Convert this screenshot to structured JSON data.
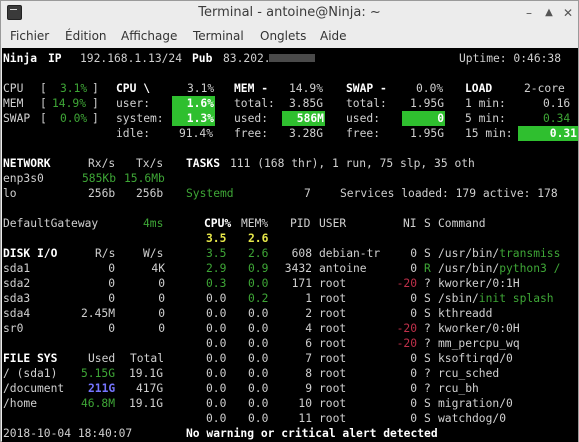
{
  "window": {
    "title": "Terminal - antoine@Ninja: ~"
  },
  "menu": [
    "Fichier",
    "Édition",
    "Affichage",
    "Terminal",
    "Onglets",
    "Aide"
  ],
  "header": {
    "host": "Ninja",
    "ip_label": "IP",
    "ip": "192.168.1.13/24",
    "pub_label": "Pub",
    "pub": "83.202.",
    "uptime": "Uptime: 0:46:38"
  },
  "quicklook": {
    "labels": [
      "CPU",
      "MEM",
      "SWAP"
    ],
    "values": [
      "3.1%",
      "14.9%",
      "0.0%"
    ],
    "bar_open": [
      "[",
      "[",
      "["
    ],
    "bar_close": [
      "]",
      "]",
      "]"
    ]
  },
  "cpu": {
    "title": "CPU \\",
    "total": "3.1%",
    "rows": [
      [
        "user:",
        "1.6%"
      ],
      [
        "system:",
        "1.3%"
      ],
      [
        "idle:",
        "91.4%"
      ]
    ]
  },
  "mem": {
    "title": "MEM -",
    "total": "14.9%",
    "rows": [
      [
        "total:",
        "3.85G"
      ],
      [
        "used:",
        "586M"
      ],
      [
        "free:",
        "3.28G"
      ]
    ]
  },
  "swap": {
    "title": "SWAP -",
    "total": "0.0%",
    "rows": [
      [
        "total:",
        "1.95G"
      ],
      [
        "used:",
        "0"
      ],
      [
        "free:",
        "1.95G"
      ]
    ]
  },
  "load": {
    "title": "LOAD",
    "cores": "2-core",
    "rows": [
      [
        "1 min:",
        "0.16"
      ],
      [
        "5 min:",
        "0.34"
      ],
      [
        "15 min:",
        "0.31"
      ]
    ]
  },
  "network": {
    "title": "NETWORK",
    "rx": "Rx/s",
    "tx": "Tx/s",
    "rows": [
      [
        "enp3s0",
        "585Kb",
        "15.6Mb"
      ],
      [
        "lo",
        "256b",
        "256b"
      ]
    ],
    "gw": "DefaultGateway",
    "gw_val": "4ms"
  },
  "tasks": {
    "label": "TASKS",
    "text": "111 (168 thr), 1 run, 75 slp, 35 oth",
    "systemd": "Systemd",
    "systemd_val": "7",
    "services": "Services loaded: 179 active: 178"
  },
  "disk": {
    "title": "DISK I/O",
    "r": "R/s",
    "w": "W/s",
    "rows": [
      [
        "sda1",
        "0",
        "4K"
      ],
      [
        "sda2",
        "0",
        "0"
      ],
      [
        "sda3",
        "0",
        "0"
      ],
      [
        "sda4",
        "2.45M",
        "0"
      ],
      [
        "sr0",
        "0",
        "0"
      ]
    ]
  },
  "fs": {
    "title": "FILE SYS",
    "used": "Used",
    "total": "Total",
    "rows": [
      [
        "/ (sda1)",
        "5.15G",
        "19.1G"
      ],
      [
        "/document",
        "211G",
        "417G"
      ],
      [
        "/home",
        "46.8M",
        "19.1G"
      ]
    ]
  },
  "proc": {
    "headers": [
      "CPU%",
      "MEM%",
      "PID",
      "USER",
      "NI",
      "S",
      "Command"
    ],
    "summary": [
      "3.5",
      "2.6"
    ],
    "rows": [
      [
        "3.5",
        "2.6",
        "608",
        "debian-tr",
        "0",
        "S",
        "/usr/bin/",
        "transmiss"
      ],
      [
        "2.9",
        "0.9",
        "3432",
        "antoine",
        "0",
        "R",
        "/usr/bin/",
        "python3 /"
      ],
      [
        "0.3",
        "0.0",
        "171",
        "root",
        "-20",
        "?",
        "kworker/0:1H",
        ""
      ],
      [
        "0.0",
        "0.2",
        "1",
        "root",
        "0",
        "S",
        "/sbin/",
        "init splash"
      ],
      [
        "0.0",
        "0.0",
        "2",
        "root",
        "0",
        "S",
        "kthreadd",
        ""
      ],
      [
        "0.0",
        "0.0",
        "4",
        "root",
        "-20",
        "?",
        "kworker/0:0H",
        ""
      ],
      [
        "0.0",
        "0.0",
        "6",
        "root",
        "-20",
        "?",
        "mm_percpu_wq",
        ""
      ],
      [
        "0.0",
        "0.0",
        "7",
        "root",
        "0",
        "S",
        "ksoftirqd/0",
        ""
      ],
      [
        "0.0",
        "0.0",
        "8",
        "root",
        "0",
        "?",
        "rcu_sched",
        ""
      ],
      [
        "0.0",
        "0.0",
        "9",
        "root",
        "0",
        "?",
        "rcu_bh",
        ""
      ],
      [
        "0.0",
        "0.0",
        "10",
        "root",
        "0",
        "S",
        "migration/0",
        ""
      ],
      [
        "0.0",
        "0.0",
        "11",
        "root",
        "0",
        "S",
        "watchdog/0",
        ""
      ]
    ]
  },
  "footer": {
    "time": "2018-10-04 18:40:07",
    "alert": "No warning or critical alert detected"
  },
  "colors": {
    "ok": "#3ea636",
    "highlight": "#2fbf2f",
    "warn": "#c0304a",
    "blue": "#7575ff"
  }
}
